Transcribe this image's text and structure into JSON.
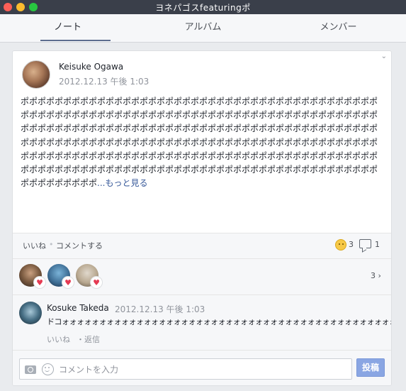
{
  "window": {
    "title": "ヨネパゴスfeaturingポ"
  },
  "tabs": [
    {
      "label": "ノート",
      "active": true
    },
    {
      "label": "アルバム",
      "active": false
    },
    {
      "label": "メンバー",
      "active": false
    }
  ],
  "post": {
    "author": "Keisuke Ogawa",
    "timestamp": "2012.12.13 午後 1:03",
    "body": "ポポポポポポポポポポポポポポポポポポポポポポポポポポポポポポポポポポポポポポポポポポポポポポポポポポポポポポポポポポポポポポポポポポポポポポポポポポポポポポポポポポポポポポポポポポポポポポポポポポポポポポポポポポポポポポポポポポポポポポポポポポポポポポポポポポポポポポポポポポポポポポポポポポポポポポポポポポポポポポポポポポポポポポポポポポポポポポポポポポポポポポポポポポポポポポポポポポポポポポポポポポポポポポポポポポポポポポポポポポポポポポポポポポポポポポポポポポポポポポポポポポポポポポポポポポポポポポポポポポポポポ",
    "see_more": "...もっと見る",
    "like_label": "いいね",
    "comment_label": "コメントする",
    "reaction_count": "3",
    "comment_count": "1"
  },
  "reactors": {
    "more_label": "3 ›"
  },
  "comment": {
    "author": "Kosuke Takeda",
    "timestamp": "2012.12.13 午後 1:03",
    "text": "ドコォォォォォォォォォォォォォォォォォォォォォォォォォォォォォォォォォォォォォォォォォォォォォォォォ",
    "like_label": "いいね",
    "separator": "・",
    "reply_label": "返信"
  },
  "composer": {
    "placeholder": "コメントを入力",
    "value": "",
    "post_label": "投稿"
  },
  "icons": {
    "close": "close-icon",
    "minimize": "minimize-icon",
    "maximize": "maximize-icon",
    "options": "chevron-down-icon",
    "reaction": "smiley-icon",
    "comments": "speech-bubble-icon",
    "heart": "heart-icon",
    "camera": "camera-icon",
    "emoji": "emoji-icon"
  },
  "colors": {
    "titlebar": "#3a3f4a",
    "close": "#fc5f57",
    "minimize": "#fdbc2e",
    "maximize": "#28c840",
    "link": "#365899",
    "post_button": "#8aa6e3",
    "heart": "#e53b53"
  }
}
